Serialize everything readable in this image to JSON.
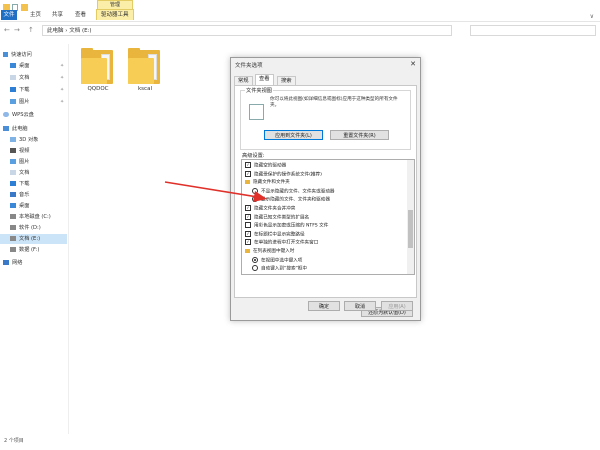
{
  "ribbon": {
    "tabs": [
      "文件",
      "主页",
      "共享",
      "查看",
      "驱动器工具"
    ],
    "context_label": "管理",
    "collapse_chevron": "∨"
  },
  "address": {
    "path": "此电脑 › 文档 (E:)",
    "back": "←",
    "forward": "→",
    "up": "↑"
  },
  "sidebar": {
    "items": [
      {
        "label": "快速访问",
        "icon": "star-icon"
      },
      {
        "label": "桌面",
        "icon": "desktop-icon",
        "pinned": true
      },
      {
        "label": "文档",
        "icon": "documents-icon",
        "pinned": true
      },
      {
        "label": "下载",
        "icon": "download-icon",
        "pinned": true
      },
      {
        "label": "图片",
        "icon": "pictures-icon",
        "pinned": true
      },
      {
        "label": "WPS云盘",
        "icon": "cloud-icon"
      },
      {
        "label": "此电脑",
        "icon": "computer-icon"
      },
      {
        "label": "3D 对象",
        "icon": "3d-objects-icon"
      },
      {
        "label": "视频",
        "icon": "video-icon"
      },
      {
        "label": "图片",
        "icon": "pictures-icon"
      },
      {
        "label": "文档",
        "icon": "documents-icon"
      },
      {
        "label": "下载",
        "icon": "download-icon"
      },
      {
        "label": "音乐",
        "icon": "music-icon"
      },
      {
        "label": "桌面",
        "icon": "desktop-icon"
      },
      {
        "label": "本地磁盘 (C:)",
        "icon": "drive-icon"
      },
      {
        "label": "软件 (D:)",
        "icon": "drive-icon"
      },
      {
        "label": "文档 (E:)",
        "icon": "drive-icon",
        "selected": true
      },
      {
        "label": "数据 (F:)",
        "icon": "drive-icon"
      },
      {
        "label": "网络",
        "icon": "network-icon"
      }
    ]
  },
  "content": {
    "folders": [
      {
        "name": "QQDOC"
      },
      {
        "name": "kscal"
      }
    ]
  },
  "status": {
    "item_count": "2 个项目"
  },
  "dialog": {
    "title": "文件夹选项",
    "close": "✕",
    "tabs": [
      "常规",
      "查看",
      "搜索"
    ],
    "active_tab": "查看",
    "folder_views_title": "文件夹视图",
    "folder_views_desc": "你可以将此视图(如详细信息或图标)应用于这种类型的所有文件夹。",
    "apply_to_folders": "应用到文件夹(L)",
    "reset_folders": "重置文件夹(R)",
    "advanced_title": "高级设置:",
    "advanced_options": [
      {
        "type": "checkbox",
        "checked": true,
        "label": "隐藏空的驱动器",
        "indent": 0
      },
      {
        "type": "checkbox",
        "checked": true,
        "label": "隐藏受保护的操作系统文件(推荐)",
        "indent": 0
      },
      {
        "type": "folder",
        "label": "隐藏文件和文件夹",
        "indent": 0
      },
      {
        "type": "radio",
        "checked": false,
        "label": "不显示隐藏的文件、文件夹或驱动器",
        "indent": 1
      },
      {
        "type": "radio",
        "checked": true,
        "label": "显示隐藏的文件、文件夹和驱动器",
        "indent": 1
      },
      {
        "type": "checkbox",
        "checked": true,
        "label": "隐藏文件夹合并冲突",
        "indent": 0
      },
      {
        "type": "checkbox",
        "checked": true,
        "label": "隐藏已知文件类型的扩展名",
        "indent": 0
      },
      {
        "type": "checkbox",
        "checked": false,
        "label": "用彩色显示加密或压缩的 NTFS 文件",
        "indent": 0
      },
      {
        "type": "checkbox",
        "checked": true,
        "label": "在标题栏中显示完整路径",
        "indent": 0
      },
      {
        "type": "checkbox",
        "checked": true,
        "label": "在单独的进程中打开文件夹窗口",
        "indent": 0
      },
      {
        "type": "folder",
        "label": "在列表视图中键入时",
        "indent": 0
      },
      {
        "type": "radio",
        "checked": true,
        "label": "在视图中选中键入项",
        "indent": 1
      },
      {
        "type": "radio",
        "checked": false,
        "label": "自动键入到“搜索”框中",
        "indent": 1
      }
    ],
    "restore_defaults": "还原为默认值(D)",
    "ok": "确定",
    "cancel": "取消",
    "apply": "应用(A)"
  },
  "colors": {
    "file_tab": "#1f6fc5",
    "context_tab": "#fbeea8",
    "selected_nav": "#cce4f7",
    "folder": "#e9b53c",
    "arrow": "#e0302a"
  }
}
